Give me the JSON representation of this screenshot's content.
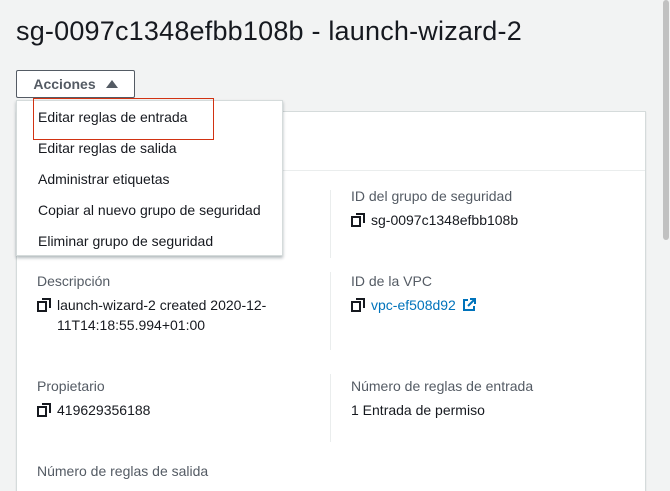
{
  "page": {
    "title": "sg-0097c1348efbb108b - launch-wizard-2"
  },
  "actions": {
    "label": "Acciones",
    "menu": [
      "Editar reglas de entrada",
      "Editar reglas de salida",
      "Administrar etiquetas",
      "Copiar al nuevo grupo de seguridad",
      "Eliminar grupo de seguridad"
    ]
  },
  "details": {
    "sg_id_label": "ID del grupo de seguridad",
    "sg_id_value": "sg-0097c1348efbb108b",
    "description_label": "Descripción",
    "description_value": "launch-wizard-2 created 2020-12-11T14:18:55.994+01:00",
    "vpc_label": "ID de la VPC",
    "vpc_value": "vpc-ef508d92",
    "owner_label": "Propietario",
    "owner_value": "419629356188",
    "inbound_label": "Número de reglas de entrada",
    "inbound_value": "1 Entrada de permiso",
    "outbound_label": "Número de reglas de salida"
  },
  "colors": {
    "link": "#0073bb",
    "highlight": "#d13212",
    "background": "#f2f3f3"
  }
}
